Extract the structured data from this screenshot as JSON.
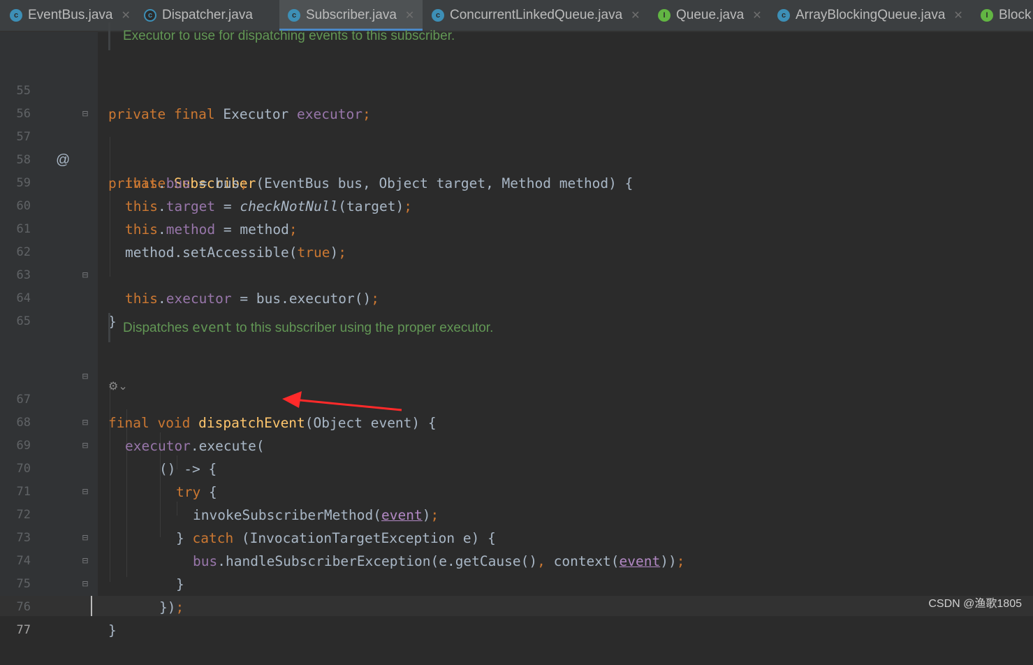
{
  "tabs": [
    {
      "label": "EventBus.java",
      "icon": "class",
      "closable": true
    },
    {
      "label": "Dispatcher.java",
      "icon": "abstract",
      "closable": false
    },
    {
      "label": "Subscriber.java",
      "icon": "class",
      "closable": true,
      "active": true
    },
    {
      "label": "ConcurrentLinkedQueue.java",
      "icon": "class",
      "closable": true
    },
    {
      "label": "Queue.java",
      "icon": "iface",
      "closable": true
    },
    {
      "label": "ArrayBlockingQueue.java",
      "icon": "class",
      "closable": true
    },
    {
      "label": "Block",
      "icon": "iface",
      "closable": false
    }
  ],
  "doc": {
    "executor_doc": "Executor to use for dispatching events to this subscriber.",
    "dispatch_doc_pre": "Dispatches ",
    "dispatch_doc_code": "event",
    "dispatch_doc_post": " to this subscriber using the proper executor."
  },
  "lines": {
    "l55": "55",
    "l56": "56",
    "l57": "57",
    "l58": "58",
    "l59": "59",
    "l60": "60",
    "l61": "61",
    "l62": "62",
    "l63": "63",
    "l64": "64",
    "l65": "65",
    "l67": "67",
    "l68": "68",
    "l69": "69",
    "l70": "70",
    "l71": "71",
    "l72": "72",
    "l73": "73",
    "l74": "74",
    "l75": "75",
    "l76": "76",
    "l77": "77"
  },
  "code": {
    "private": "private",
    "final": "final",
    "Executor": " Executor ",
    "executor": "executor",
    "semi": ";",
    "Subscriber": "Subscriber",
    "ctor_params": "(EventBus bus, Object target, Method method) {",
    "this": "this",
    "dot": ".",
    "bus": "bus",
    "eq_bus": " = bus",
    "target": "target",
    "eq": " = ",
    "checkNotNull": "checkNotNull",
    "target_arg": "(target)",
    "method": "method",
    "eq_method": " = method",
    "setAccessible": "method.setAccessible(",
    "true": "true",
    "close_paren": ")",
    "eq_bus_exec": " = bus.executor()",
    "brace_close": "}",
    "void": "void",
    "dispatchEvent": "dispatchEvent",
    "dispatch_params": "(Object event) {",
    "execute": ".execute(",
    "lambda": "() -> {",
    "try": "try",
    "brace_open": " {",
    "invoke": "invokeSubscriberMethod(",
    "event": "event",
    "catch_pre": "} ",
    "catch": "catch",
    "catch_post": " (InvocationTargetException e) {",
    "handle": ".handleSubscriberException(e.getCause()",
    "comma": ",",
    "context": " context(",
    "close2": "))",
    "lambda_close": "})",
    "at_sign": "@"
  },
  "watermark": "CSDN @渔歌1805",
  "colors": {
    "background": "#2b2b2b",
    "keyword": "#cc7832",
    "field": "#9876aa",
    "function": "#ffc66d",
    "doc": "#629755",
    "text": "#a9b7c6",
    "arrow": "#ff2a2a"
  }
}
